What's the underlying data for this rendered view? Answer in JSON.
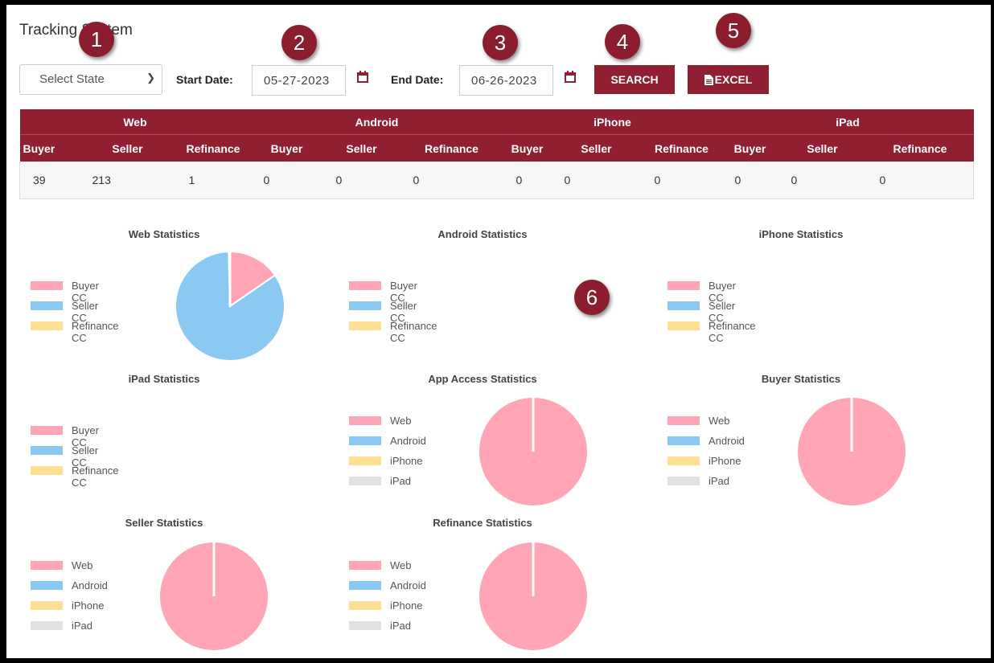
{
  "title": "Tracking System",
  "filters": {
    "state_select": "Select State",
    "start_label": "Start Date:",
    "start_value": "05-27-2023",
    "end_label": "End Date:",
    "end_value": "06-26-2023",
    "search_label": "SEARCH",
    "excel_label": "EXCEL"
  },
  "markers": [
    "1",
    "2",
    "3",
    "4",
    "5",
    "6"
  ],
  "table": {
    "groups": [
      "Web",
      "Android",
      "iPhone",
      "iPad"
    ],
    "columns": [
      "Buyer",
      "Seller",
      "Refinance",
      "Buyer",
      "Seller",
      "Refinance",
      "Buyer",
      "Seller",
      "Refinance",
      "Buyer",
      "Seller",
      "Refinance"
    ],
    "values": [
      "39",
      "213",
      "1",
      "0",
      "0",
      "0",
      "0",
      "0",
      "0",
      "0",
      "0",
      "0"
    ]
  },
  "colors": {
    "brand": "#8f1f31",
    "pink": "#ffa5b6",
    "blue": "#8bc8f2",
    "yellow": "#fddf94",
    "gray": "#e2e2e2"
  },
  "chart_data": [
    {
      "type": "pie",
      "title": "Web Statistics",
      "labels": [
        "Buyer CC",
        "Seller CC",
        "Refinance CC"
      ],
      "values": [
        39,
        213,
        1
      ]
    },
    {
      "type": "pie",
      "title": "Android Statistics",
      "labels": [
        "Buyer CC",
        "Seller CC",
        "Refinance CC"
      ],
      "values": [
        0,
        0,
        0
      ]
    },
    {
      "type": "pie",
      "title": "iPhone Statistics",
      "labels": [
        "Buyer CC",
        "Seller CC",
        "Refinance CC"
      ],
      "values": [
        0,
        0,
        0
      ]
    },
    {
      "type": "pie",
      "title": "iPad Statistics",
      "labels": [
        "Buyer CC",
        "Seller CC",
        "Refinance CC"
      ],
      "values": [
        0,
        0,
        0
      ]
    },
    {
      "type": "pie",
      "title": "App Access Statistics",
      "labels": [
        "Web",
        "Android",
        "iPhone",
        "iPad"
      ],
      "values": [
        253,
        0,
        0,
        0
      ]
    },
    {
      "type": "pie",
      "title": "Buyer Statistics",
      "labels": [
        "Web",
        "Android",
        "iPhone",
        "iPad"
      ],
      "values": [
        39,
        0,
        0,
        0
      ]
    },
    {
      "type": "pie",
      "title": "Seller Statistics",
      "labels": [
        "Web",
        "Android",
        "iPhone",
        "iPad"
      ],
      "values": [
        213,
        0,
        0,
        0
      ]
    },
    {
      "type": "pie",
      "title": "Refinance Statistics",
      "labels": [
        "Web",
        "Android",
        "iPhone",
        "iPad"
      ],
      "values": [
        1,
        0,
        0,
        0
      ]
    }
  ]
}
